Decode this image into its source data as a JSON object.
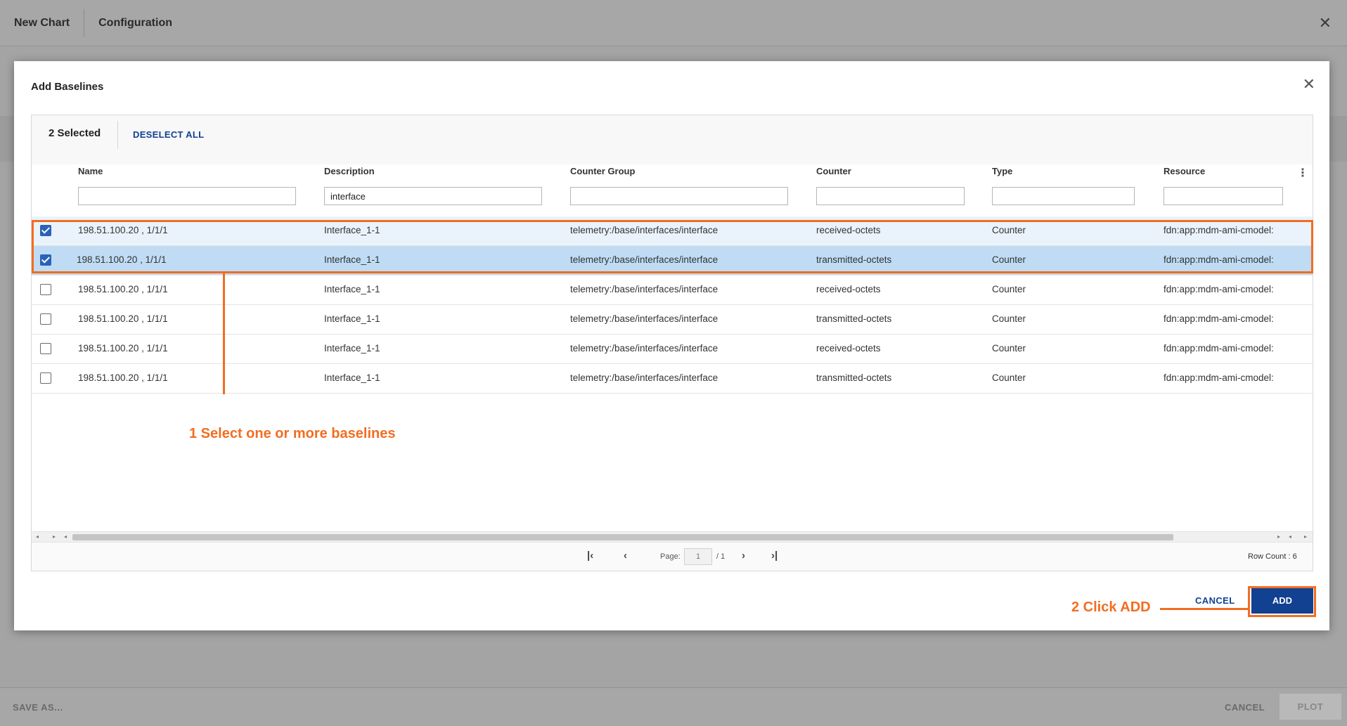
{
  "app": {
    "tabs": [
      "New Chart",
      "Configuration"
    ],
    "footer": {
      "save_as": "SAVE AS...",
      "cancel": "CANCEL",
      "plot": "PLOT"
    }
  },
  "modal": {
    "title": "Add Baselines",
    "selection": {
      "count_label": "2 Selected",
      "deselect_label": "DESELECT ALL"
    },
    "columns": [
      "Name",
      "Description",
      "Counter Group",
      "Counter",
      "Type",
      "Resource"
    ],
    "filters": {
      "name": "",
      "description": "interface",
      "counter_group": "",
      "counter": "",
      "type": "",
      "resource": ""
    },
    "rows": [
      {
        "checked": true,
        "name": "198.51.100.20 , 1/1/1",
        "description": "Interface_1-1",
        "counter_group": "telemetry:/base/interfaces/interface",
        "counter": "received-octets",
        "type": "Counter",
        "resource": "fdn:app:mdm-ami-cmodel:"
      },
      {
        "checked": true,
        "name": "198.51.100.20 , 1/1/1",
        "description": "Interface_1-1",
        "counter_group": "telemetry:/base/interfaces/interface",
        "counter": "transmitted-octets",
        "type": "Counter",
        "resource": "fdn:app:mdm-ami-cmodel:"
      },
      {
        "checked": false,
        "name": "198.51.100.20 , 1/1/1",
        "description": "Interface_1-1",
        "counter_group": "telemetry:/base/interfaces/interface",
        "counter": "received-octets",
        "type": "Counter",
        "resource": "fdn:app:mdm-ami-cmodel:"
      },
      {
        "checked": false,
        "name": "198.51.100.20 , 1/1/1",
        "description": "Interface_1-1",
        "counter_group": "telemetry:/base/interfaces/interface",
        "counter": "transmitted-octets",
        "type": "Counter",
        "resource": "fdn:app:mdm-ami-cmodel:"
      },
      {
        "checked": false,
        "name": "198.51.100.20 , 1/1/1",
        "description": "Interface_1-1",
        "counter_group": "telemetry:/base/interfaces/interface",
        "counter": "received-octets",
        "type": "Counter",
        "resource": "fdn:app:mdm-ami-cmodel:"
      },
      {
        "checked": false,
        "name": "198.51.100.20 , 1/1/1",
        "description": "Interface_1-1",
        "counter_group": "telemetry:/base/interfaces/interface",
        "counter": "transmitted-octets",
        "type": "Counter",
        "resource": "fdn:app:mdm-ami-cmodel:"
      }
    ],
    "pagination": {
      "page_label": "Page:",
      "current_page": "1",
      "total": "/ 1",
      "row_count": "Row Count : 6"
    },
    "buttons": {
      "cancel": "CANCEL",
      "add": "ADD"
    }
  },
  "annotations": {
    "step1": "1 Select one or more baselines",
    "step2": "2 Click ADD"
  },
  "colors": {
    "accent": "#124191",
    "callout": "#f26d21",
    "selected_row": "#bfdcf4",
    "checkbox": "#2a62b7"
  },
  "icons": [
    "close-icon",
    "kebab-menu-icon",
    "checkbox-icon",
    "first-page-icon",
    "previous-page-icon",
    "next-page-icon",
    "last-page-icon",
    "scroll-arrow-icon"
  ]
}
